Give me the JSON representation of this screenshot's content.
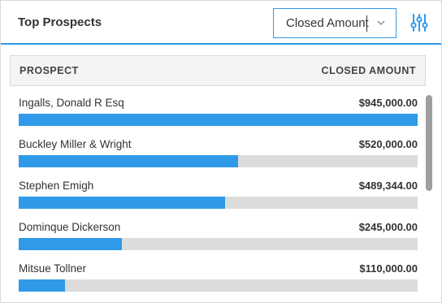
{
  "widget": {
    "title": "Top Prospects",
    "sort_select": {
      "value": "Closed Amount"
    },
    "settings_icon": "sliders-icon",
    "accent_color": "#2f9ae8"
  },
  "table": {
    "columns": {
      "prospect": "PROSPECT",
      "closed_amount": "CLOSED AMOUNT"
    },
    "max_amount": 945000,
    "rows": [
      {
        "name": "Ingalls, Donald R Esq",
        "amount": "$945,000.00",
        "value": 945000
      },
      {
        "name": "Buckley Miller & Wright",
        "amount": "$520,000.00",
        "value": 520000
      },
      {
        "name": "Stephen Emigh",
        "amount": "$489,344.00",
        "value": 489344
      },
      {
        "name": "Dominque Dickerson",
        "amount": "$245,000.00",
        "value": 245000
      },
      {
        "name": "Mitsue Tollner",
        "amount": "$110,000.00",
        "value": 110000
      }
    ]
  }
}
